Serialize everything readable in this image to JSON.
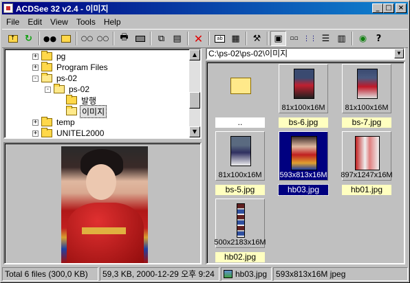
{
  "title": "ACDSee 32 v2.4 - 이미지",
  "title_buttons": {
    "minimize": "_",
    "maximize": "□",
    "close": "×"
  },
  "menu": [
    "File",
    "Edit",
    "View",
    "Tools",
    "Help"
  ],
  "toolbar_icons": [
    "folder-up-icon",
    "refresh-icon",
    "binoculars-icon",
    "photo-folder-icon",
    "previous-icon",
    "next-icon",
    "print-icon",
    "scanner-icon",
    "copy-icon",
    "move-icon",
    "delete-icon",
    "rename-icon",
    "properties-icon",
    "tools-icon",
    "large-icons-icon",
    "small-icons-icon",
    "list-icon",
    "details-icon",
    "thumbnails-icon",
    "view-icon",
    "help-icon"
  ],
  "tree": [
    {
      "label": "pg",
      "indent": 1,
      "expander": "+",
      "open": false
    },
    {
      "label": "Program Files",
      "indent": 1,
      "expander": "+",
      "open": false
    },
    {
      "label": "ps-02",
      "indent": 1,
      "expander": "-",
      "open": true
    },
    {
      "label": "ps-02",
      "indent": 2,
      "expander": "-",
      "open": true
    },
    {
      "label": "발행",
      "indent": 3,
      "expander": "",
      "open": false
    },
    {
      "label": "이미지",
      "indent": 3,
      "expander": "",
      "open": true,
      "selected": true
    },
    {
      "label": "temp",
      "indent": 1,
      "expander": "+",
      "open": false
    },
    {
      "label": "UNITEL2000",
      "indent": 1,
      "expander": "+",
      "open": false
    }
  ],
  "address": "C:\\ps-02\\ps-02\\이미지",
  "files": [
    {
      "name": "..",
      "info": "",
      "kind": "up"
    },
    {
      "name": "bs-6.jpg",
      "info": "81x100x16M",
      "kind": "img"
    },
    {
      "name": "bs-7.jpg",
      "info": "81x100x16M",
      "kind": "img"
    },
    {
      "name": "bs-5.jpg",
      "info": "81x100x16M",
      "kind": "img"
    },
    {
      "name": "hb03.jpg",
      "info": "593x813x16M",
      "kind": "img",
      "selected": true
    },
    {
      "name": "hb01.jpg",
      "info": "897x1247x16M",
      "kind": "img"
    },
    {
      "name": "hb02.jpg",
      "info": "500x2183x16M",
      "kind": "img"
    }
  ],
  "status": {
    "total": "Total 6 files (300,0 KB)",
    "selected": "59,3 KB, 2000-12-29 오후 9:24",
    "filename": "hb03.jpg",
    "dimensions": "593x813x16M jpeg"
  },
  "colors": {
    "selection": "#000080",
    "title_start": "#000080",
    "title_end": "#1084d0",
    "label_bg": "#ffffc0"
  }
}
